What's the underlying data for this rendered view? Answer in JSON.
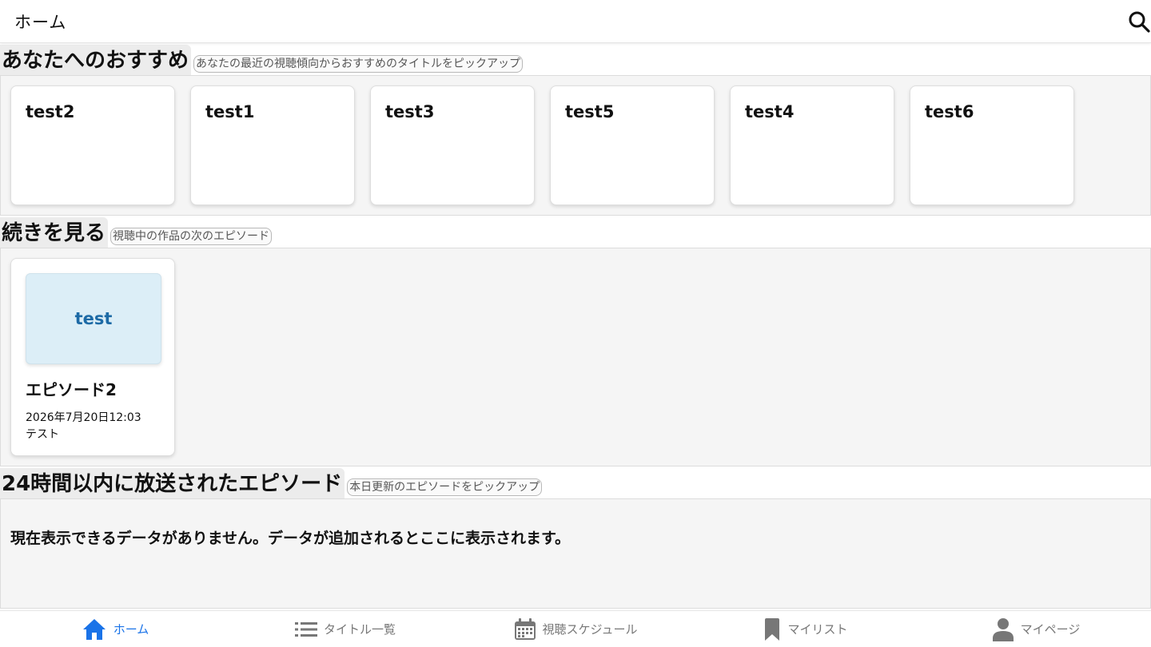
{
  "header": {
    "title": "ホーム"
  },
  "sections": {
    "recommend": {
      "title": "あなたへのおすすめ",
      "subtitle": "あなたの最近の視聴傾向からおすすめのタイトルをピックアップ",
      "cards": [
        "test2",
        "test1",
        "test3",
        "test5",
        "test4",
        "test6"
      ]
    },
    "continue": {
      "title": "続きを見る",
      "subtitle": "視聴中の作品の次のエピソード",
      "episode": {
        "thumb_label": "test",
        "title": "エピソード2",
        "date": "2026年7月20日12:03",
        "desc": "テスト"
      }
    },
    "recent": {
      "title": "24時間以内に放送されたエピソード",
      "subtitle": "本日更新のエピソードをピックアップ",
      "empty": "現在表示できるデータがありません。データが追加されるとここに表示されます。"
    }
  },
  "nav": {
    "items": [
      {
        "label": "ホーム",
        "icon": "home-icon",
        "active": true
      },
      {
        "label": "タイトル一覧",
        "icon": "list-icon",
        "active": false
      },
      {
        "label": "視聴スケジュール",
        "icon": "calendar-icon",
        "active": false
      },
      {
        "label": "マイリスト",
        "icon": "bookmark-icon",
        "active": false
      },
      {
        "label": "マイページ",
        "icon": "person-icon",
        "active": false
      }
    ]
  },
  "colors": {
    "accent": "#1a73e8",
    "inactive": "#777777",
    "thumb_bg": "#dceef7",
    "thumb_text": "#1c6aa6"
  }
}
